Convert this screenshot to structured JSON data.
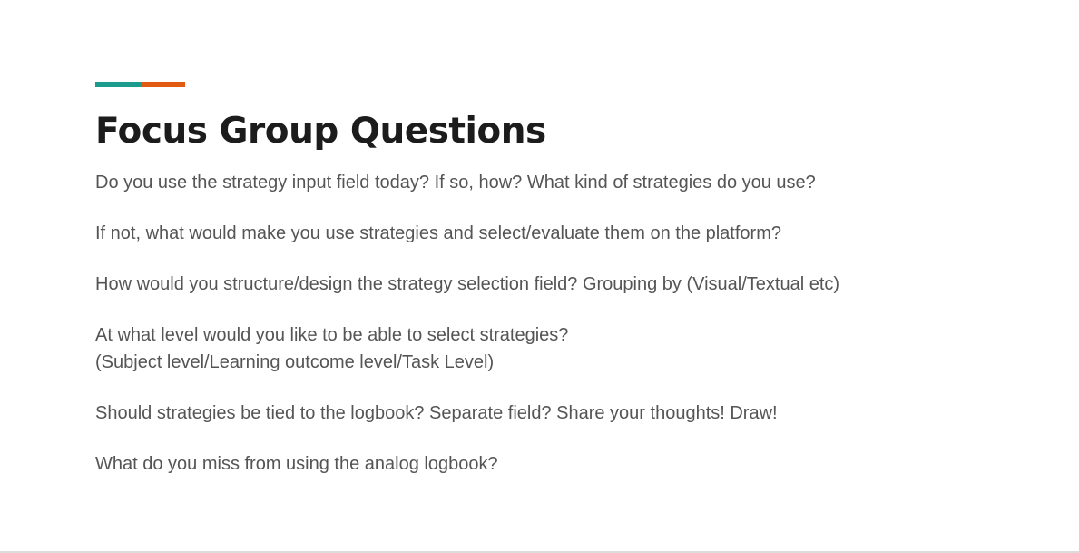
{
  "slide": {
    "title": "Focus Group Questions",
    "accent_colors": [
      "#1a9b8c",
      "#e05a12"
    ],
    "questions": [
      [
        "Do you use the strategy input field today? If so, how? What kind of strategies do you use?"
      ],
      [
        "If not, what would make you use strategies and select/evaluate them on the platform?"
      ],
      [
        "How would you structure/design the strategy selection field? Grouping by (Visual/Textual etc)"
      ],
      [
        "At what level would you like to be able to select strategies?",
        "(Subject level/Learning outcome level/Task Level)"
      ],
      [
        "Should strategies be tied to the logbook? Separate field? Share your thoughts! Draw!"
      ],
      [
        "What do you miss from using the analog logbook?"
      ]
    ]
  }
}
